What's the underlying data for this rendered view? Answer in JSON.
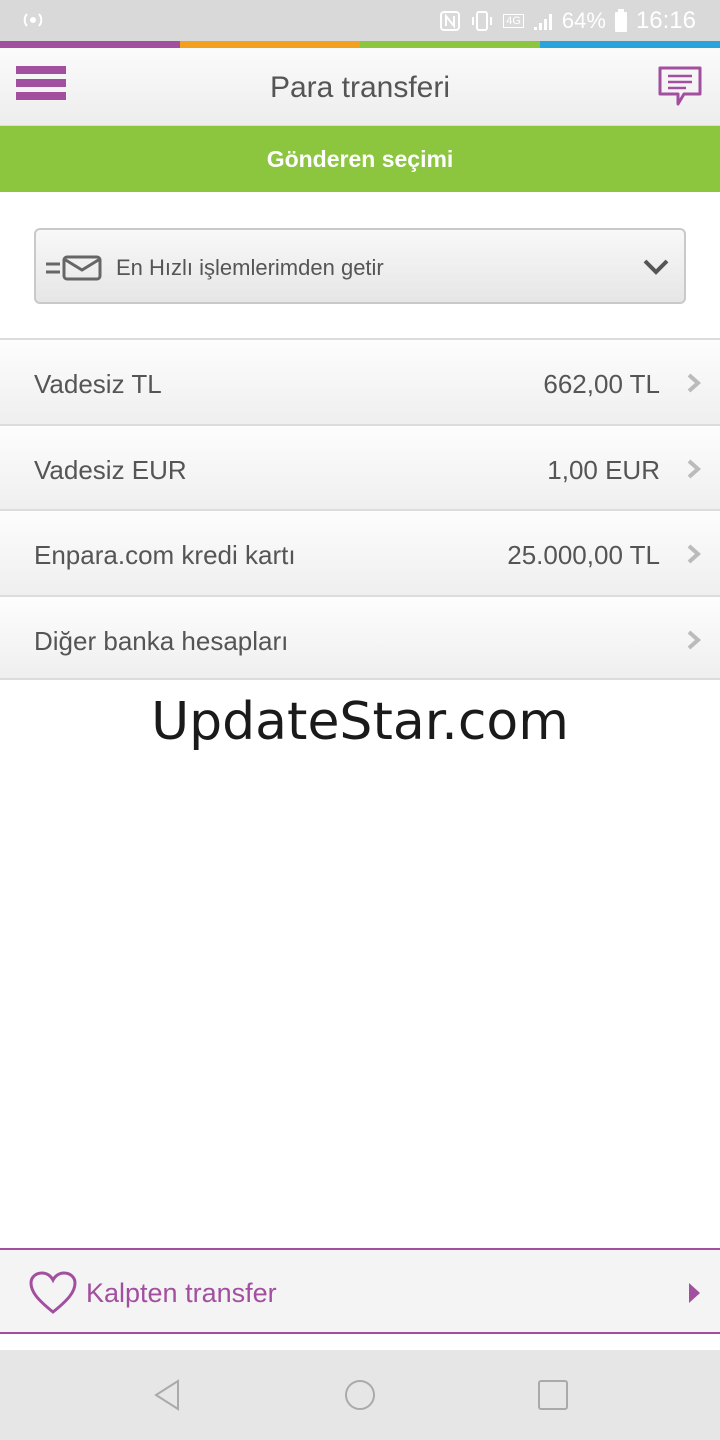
{
  "status_bar": {
    "battery": "64%",
    "time": "16:16",
    "network": "4G"
  },
  "accent_colors": [
    "#a24f9f",
    "#f2a01e",
    "#8cc63f",
    "#29a3dc"
  ],
  "header": {
    "title": "Para transferi",
    "menu_icon": "hamburger-menu-icon",
    "chat_icon": "chat-bubble-icon"
  },
  "section": {
    "title": "Gönderen seçimi"
  },
  "quick_select": {
    "label": "En Hızlı işlemlerimden getir",
    "icon": "fast-mail-icon"
  },
  "accounts": [
    {
      "label": "Vadesiz TL",
      "value": "662,00 TL"
    },
    {
      "label": "Vadesiz EUR",
      "value": "1,00 EUR"
    },
    {
      "label": "Enpara.com kredi kartı",
      "value": "25.000,00 TL"
    },
    {
      "label": "Diğer banka hesapları",
      "value": ""
    }
  ],
  "watermark": "UpdateStar.com",
  "bottom_action": {
    "label": "Kalpten transfer",
    "icon": "heart-icon"
  }
}
